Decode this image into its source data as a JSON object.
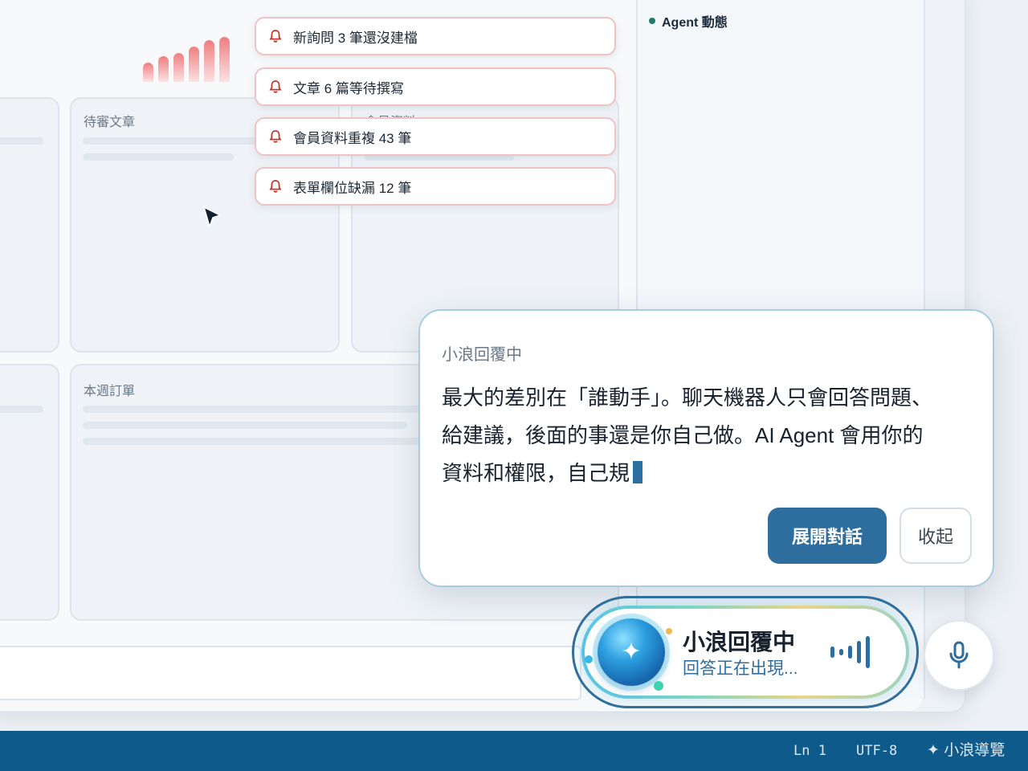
{
  "dashboard": {
    "cards": [
      {
        "title": "待審文章"
      },
      {
        "title": "會員資料"
      },
      {
        "title": "本週訂單"
      }
    ],
    "mini_chart": {
      "values": [
        3,
        4,
        4.5,
        5.5,
        6.5,
        7
      ]
    }
  },
  "agent_panel": {
    "title": "Agent 動態"
  },
  "notifications": [
    {
      "text": "新詢問 3 筆還沒建檔",
      "icon": "bell-icon"
    },
    {
      "text": "文章 6 篇等待撰寫",
      "icon": "bell-icon"
    },
    {
      "text": "會員資料重複 43 筆",
      "icon": "bell-icon"
    },
    {
      "text": "表單欄位缺漏 12 筆",
      "icon": "bell-icon"
    }
  ],
  "reply": {
    "status": "小浪回覆中",
    "line1": "最大的差別在「誰動手」。聊天機器人只會回答問題、",
    "line2": "給建議，後面的事還是你自己做。AI Agent 會用你的",
    "line3": "資料和權限，自己規",
    "expand_label": "展開對話",
    "collapse_label": "收起"
  },
  "voice": {
    "title": "小浪回覆中",
    "subtitle": "回答正在出現...",
    "orb_icon": "sparkle-icon"
  },
  "status_bar": {
    "line": "Ln 1",
    "encoding": "UTF-8",
    "nav_label": "小浪導覽",
    "nav_icon": "✦"
  },
  "colors": {
    "accent": "#2e6e9e",
    "statusbar": "#0e5a8a",
    "notif_border": "#efc3c3",
    "bell": "#c0392b"
  }
}
